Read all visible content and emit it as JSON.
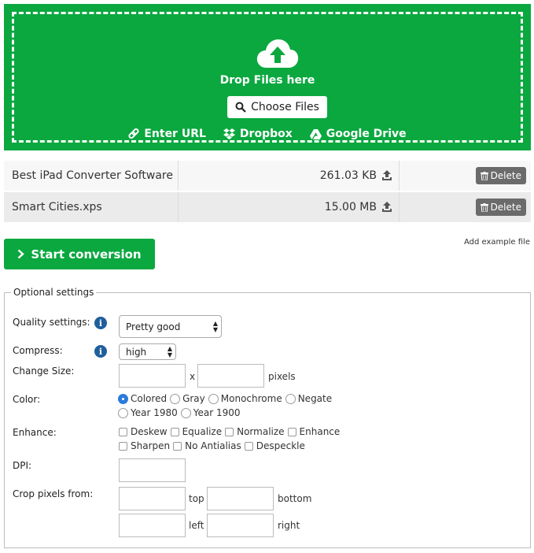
{
  "upload": {
    "drop_label": "Drop Files here",
    "choose_label": "Choose Files",
    "sources": [
      {
        "label": "Enter URL",
        "icon": "link-icon"
      },
      {
        "label": "Dropbox",
        "icon": "dropbox-icon"
      },
      {
        "label": "Google Drive",
        "icon": "google-drive-icon"
      }
    ]
  },
  "files": [
    {
      "name": "Best iPad Converter Software",
      "size": "261.03 KB",
      "delete_label": "Delete"
    },
    {
      "name": "Smart Cities.xps",
      "size": "15.00 MB",
      "delete_label": "Delete"
    }
  ],
  "actions": {
    "start_label": "Start conversion",
    "add_example_label": "Add example file"
  },
  "settings": {
    "legend": "Optional settings",
    "quality": {
      "label": "Quality settings:",
      "value": "Pretty good"
    },
    "compress": {
      "label": "Compress:",
      "value": "high"
    },
    "change_size": {
      "label": "Change Size:",
      "separator": "x",
      "unit": "pixels"
    },
    "color": {
      "label": "Color:",
      "options": [
        {
          "label": "Colored",
          "selected": true
        },
        {
          "label": "Gray",
          "selected": false
        },
        {
          "label": "Monochrome",
          "selected": false
        },
        {
          "label": "Negate",
          "selected": false
        },
        {
          "label": "Year 1980",
          "selected": false
        },
        {
          "label": "Year 1900",
          "selected": false
        }
      ]
    },
    "enhance": {
      "label": "Enhance:",
      "options": [
        "Deskew",
        "Equalize",
        "Normalize",
        "Enhance",
        "Sharpen",
        "No Antialias",
        "Despeckle"
      ]
    },
    "dpi": {
      "label": "DPI:"
    },
    "crop": {
      "label": "Crop pixels from:",
      "top": "top",
      "bottom": "bottom",
      "left": "left",
      "right": "right"
    }
  },
  "colors": {
    "brand_green": "#0aa83f",
    "info_blue": "#1f5f9c",
    "radio_blue": "#2b7bdc",
    "delete_gray": "#6b6b6b"
  }
}
